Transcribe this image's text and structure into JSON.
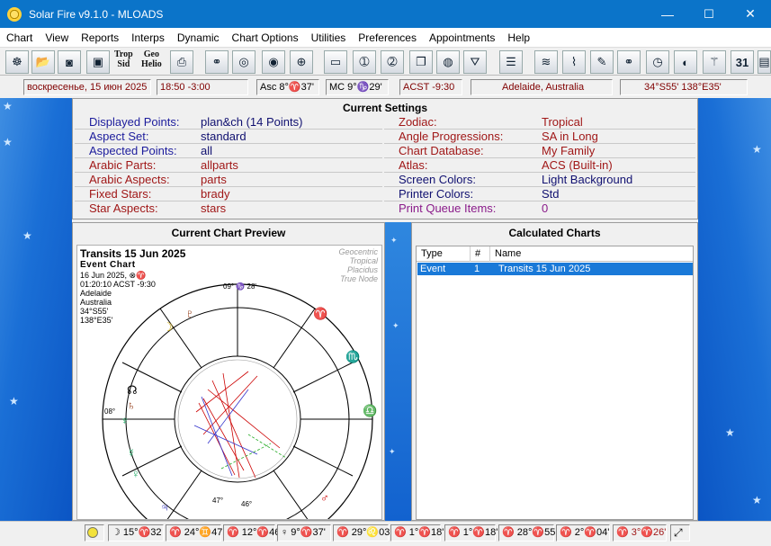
{
  "window": {
    "title": "Solar Fire v9.1.0  -  MLOADS",
    "minimize": "—",
    "maximize": "☐",
    "close": "✕"
  },
  "menu": [
    "Chart",
    "View",
    "Reports",
    "Interps",
    "Dynamic",
    "Chart Options",
    "Utilities",
    "Preferences",
    "Appointments",
    "Help"
  ],
  "toolbar": {
    "trop": "Trop",
    "sid": "Sid",
    "geo": "Geo",
    "helio": "Helio",
    "calendar_day": "31"
  },
  "info_bar": {
    "date": "воскресенье, 15 июн 2025",
    "time": "18:50  -3:00",
    "asc": "Asc 8°♈37'",
    "mc": "MC 9°♑29'",
    "acst": "ACST -9:30",
    "location": "Adelaide, Australia",
    "coords": "34°S55'  138°E35'"
  },
  "settings": {
    "title": "Current Settings",
    "left": [
      {
        "key": "Displayed Points:",
        "value": "plan&ch  (14 Points)"
      },
      {
        "key": "Aspect Set:",
        "value": "standard"
      },
      {
        "key": "Aspected Points:",
        "value": "all"
      },
      {
        "key": "Arabic Parts:",
        "value": "allparts"
      },
      {
        "key": "Arabic Aspects:",
        "value": "parts"
      },
      {
        "key": "Fixed Stars:",
        "value": "brady"
      },
      {
        "key": "Star Aspects:",
        "value": "stars"
      }
    ],
    "right": [
      {
        "key": "Zodiac:",
        "value": "Tropical"
      },
      {
        "key": "Angle Progressions:",
        "value": "SA in Long"
      },
      {
        "key": "Chart Database:",
        "value": "My Family"
      },
      {
        "key": "Atlas:",
        "value": "ACS  (Built-in)"
      },
      {
        "key": "Screen Colors:",
        "value": "Light Background"
      },
      {
        "key": "Printer Colors:",
        "value": "Std"
      },
      {
        "key": "Print Queue Items:",
        "value": "0"
      }
    ]
  },
  "preview": {
    "title": "Current Chart Preview",
    "chart_name": "Transits 15 Jun 2025",
    "chart_type": "Event Chart",
    "date": "16 Jun 2025, ⊗♈",
    "time": "01:20:10  ACST  -9:30",
    "city": "Adelaide",
    "country": "Australia",
    "lat": "34°S55'",
    "lon": "138°E35'",
    "options": [
      "Geocentric",
      "Tropical",
      "Placidus",
      "True Node"
    ],
    "cusps": {
      "top": "09°  ♑  28'",
      "left": "08°",
      "right": "08°",
      "bottom_a": "47°",
      "bottom_b": "46°"
    }
  },
  "calculated": {
    "title": "Calculated Charts",
    "columns": [
      "Type",
      "#",
      "Name"
    ],
    "rows": [
      {
        "type": "Event",
        "num": "1",
        "name": "Transits 15 Jun 2025"
      }
    ]
  },
  "bottom_bar": [
    "☽ 15°♈32",
    "♈ 24°♊47",
    "♈ 12°♈46",
    "♀ 9°♈37'",
    "♈ 29°♌03",
    "♈ 1°♈18'",
    "♈ 1°♈18'",
    "♈ 28°♈55",
    "♈ 2°♈04'",
    "♈ 3°♈26'"
  ]
}
